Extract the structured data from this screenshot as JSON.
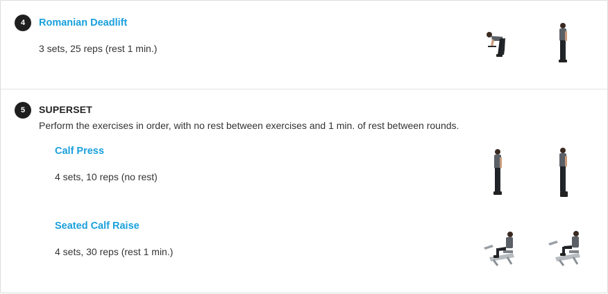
{
  "exercise4": {
    "number": "4",
    "title": "Romanian Deadlift",
    "detail": "3 sets, 25 reps (rest 1 min.)"
  },
  "superset": {
    "number": "5",
    "title": "SUPERSET",
    "description": "Perform the exercises in order, with no rest between exercises and 1 min. of rest between rounds.",
    "exercises": [
      {
        "title": "Calf Press",
        "detail": "4 sets, 10 reps (no rest)"
      },
      {
        "title": "Seated Calf Raise",
        "detail": "4 sets, 30 reps (rest 1 min.)"
      }
    ]
  },
  "colors": {
    "link": "#1aa0dc",
    "badge": "#1f1f1f",
    "divider": "#e2e2e2"
  }
}
